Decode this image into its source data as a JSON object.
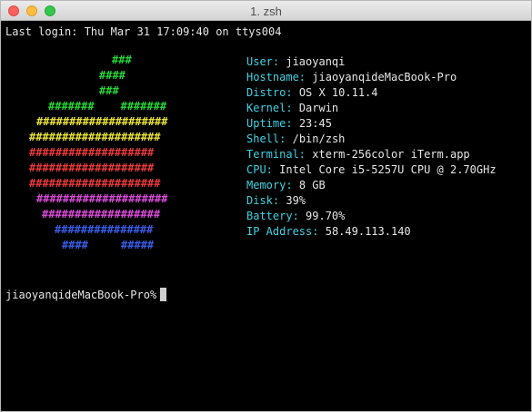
{
  "window": {
    "title": "1. zsh"
  },
  "terminal": {
    "last_login": "Last login: Thu Mar 31 17:09:40 on ttys004",
    "prompt": "jiaoyanqideMacBook-Pro%",
    "logo": {
      "rows": [
        {
          "text": "###",
          "color": "#27d437"
        },
        {
          "text": "####",
          "color": "#27d437"
        },
        {
          "text": "###",
          "color": "#27d437"
        },
        {
          "text": "#######    #######",
          "color": "#27d437"
        },
        {
          "text": "####################",
          "color": "#e8e23a"
        },
        {
          "text": "####################",
          "color": "#e8e23a"
        },
        {
          "text": "###################",
          "color": "#e83a3a"
        },
        {
          "text": "###################",
          "color": "#e83a3a"
        },
        {
          "text": "####################",
          "color": "#e83a3a"
        },
        {
          "text": "####################",
          "color": "#d94bd9"
        },
        {
          "text": "##################",
          "color": "#d94bd9"
        },
        {
          "text": "###############",
          "color": "#3a5ce8"
        },
        {
          "text": "####     #####",
          "color": "#3a5ce8"
        }
      ]
    },
    "info": [
      {
        "label": "User:",
        "value": "jiaoyanqi"
      },
      {
        "label": "Hostname:",
        "value": "jiaoyanqideMacBook-Pro"
      },
      {
        "label": "Distro:",
        "value": "OS X 10.11.4"
      },
      {
        "label": "Kernel:",
        "value": "Darwin"
      },
      {
        "label": "Uptime:",
        "value": "23:45"
      },
      {
        "label": "Shell:",
        "value": "/bin/zsh"
      },
      {
        "label": "Terminal:",
        "value": "xterm-256color iTerm.app"
      },
      {
        "label": "CPU:",
        "value": "Intel Core i5-5257U CPU @ 2.70GHz"
      },
      {
        "label": "Memory:",
        "value": "8 GB"
      },
      {
        "label": "Disk:",
        "value": "39%"
      },
      {
        "label": "Battery:",
        "value": "99.70%"
      },
      {
        "label": "IP Address:",
        "value": "58.49.113.140"
      }
    ]
  }
}
